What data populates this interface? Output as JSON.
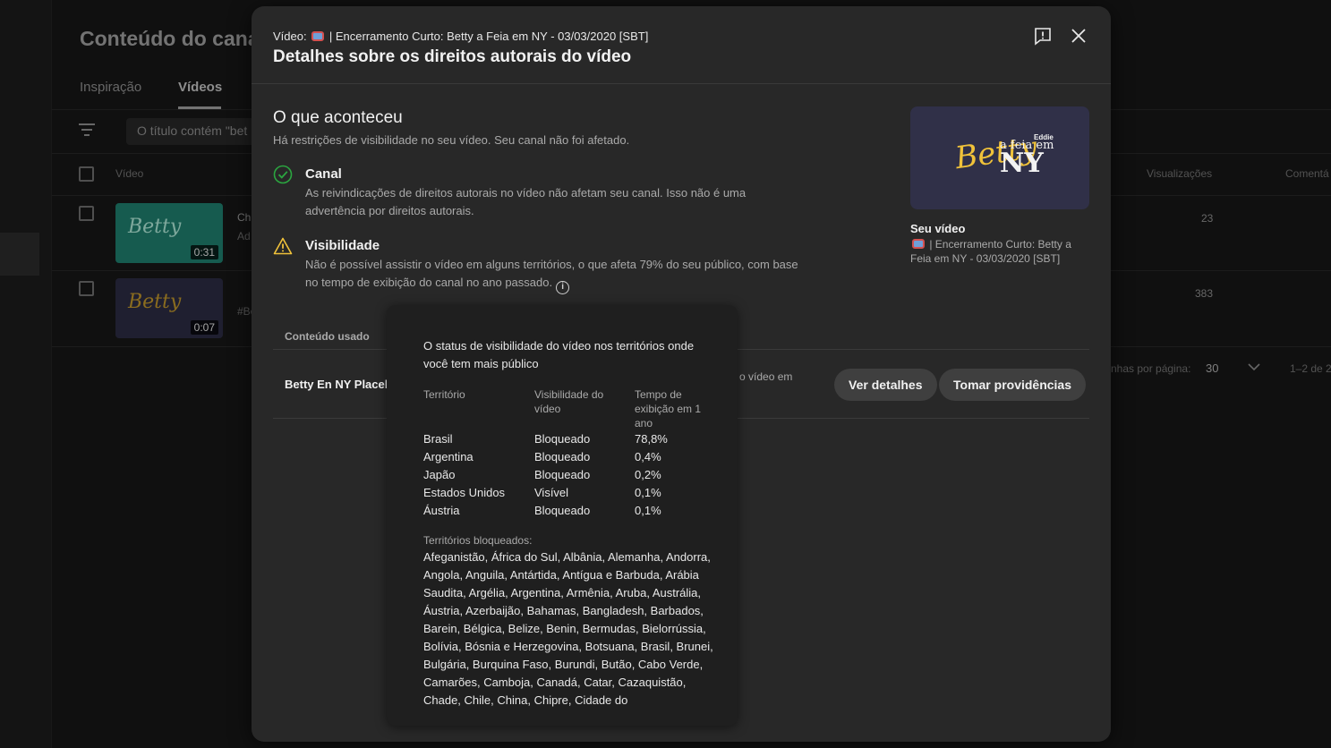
{
  "background": {
    "page_title": "Conteúdo do canal",
    "tabs": [
      "Inspiração",
      "Vídeos"
    ],
    "filter_text": "O título contém \"bet",
    "columns": {
      "video": "Vídeo",
      "views": "Visualizações",
      "comments": "Comentá"
    },
    "rows": [
      {
        "thumb_text": "Betty",
        "duration": "0:31",
        "title_snip": "Ch",
        "desc_snip": "Ad",
        "views": "23"
      },
      {
        "thumb_text": "Betty",
        "duration": "0:07",
        "title_snip": "",
        "desc_snip": "#Be",
        "views": "383"
      }
    ],
    "footer": {
      "rows_per_page_label": "nhas por página:",
      "rows_per_page_value": "30",
      "range": "1–2 de 2"
    }
  },
  "dialog": {
    "subtitle_prefix": "Vídeo:",
    "subtitle_rest": "| Encerramento Curto: Betty a Feia em NY - 03/03/2020 [SBT]",
    "title": "Detalhes sobre os direitos autorais do vídeo",
    "what_happened": {
      "title": "O que aconteceu",
      "subtitle": "Há restrições de visibilidade no seu vídeo. Seu canal não foi afetado."
    },
    "channel": {
      "title": "Canal",
      "text": "As reivindicações de direitos autorais no vídeo não afetam seu canal. Isso não é uma advertência por direitos autorais."
    },
    "visibility": {
      "title": "Visibilidade",
      "text": "Não é possível assistir o vídeo em alguns territórios, o que afeta 79% do seu público, com base no tempo de exibição do canal no ano passado."
    },
    "your_video": {
      "label": "Seu vídeo",
      "title": "| Encerramento Curto: Betty a Feia em NY - 03/03/2020 [SBT]",
      "thumb_betty": "Betty",
      "thumb_afeia": "a feia em",
      "thumb_ny": "NY",
      "thumb_eddie": "Eddie"
    },
    "content_used": {
      "header": "Conteúdo usado",
      "row_name": "Betty En NY Placeho",
      "row_desc": "o vídeo em",
      "ver_detalhes": "Ver detalhes",
      "tomar_providencias": "Tomar providências"
    }
  },
  "tooltip": {
    "heading": "O status de visibilidade do vídeo nos territórios onde você tem mais público",
    "col_territory": "Território",
    "col_visibility": "Visibilidade do vídeo",
    "col_watchtime": "Tempo de exibição em 1 ano",
    "rows": [
      {
        "territory": "Brasil",
        "visibility": "Bloqueado",
        "watchtime": "78,8%"
      },
      {
        "territory": "Argentina",
        "visibility": "Bloqueado",
        "watchtime": "0,4%"
      },
      {
        "territory": "Japão",
        "visibility": "Bloqueado",
        "watchtime": "0,2%"
      },
      {
        "territory": "Estados Unidos",
        "visibility": "Visível",
        "watchtime": "0,1%"
      },
      {
        "territory": "Áustria",
        "visibility": "Bloqueado",
        "watchtime": "0,1%"
      }
    ],
    "blocked_label": "Territórios bloqueados:",
    "blocked_list": "Afeganistão, África do Sul, Albânia, Alemanha, Andorra, Angola, Anguila, Antártida, Antígua e Barbuda, Arábia Saudita, Argélia, Argentina, Armênia, Aruba, Austrália, Áustria, Azerbaijão, Bahamas, Bangladesh, Barbados, Barein, Bélgica, Belize, Benin, Bermudas, Bielorrússia, Bolívia, Bósnia e Herzegovina, Botsuana, Brasil, Brunei, Bulgária, Burquina Faso, Burundi, Butão, Cabo Verde, Camarões, Camboja, Canadá, Catar, Cazaquistão, Chade, Chile, China, Chipre, Cidade do"
  },
  "colors": {
    "check_green": "#2ba640",
    "warning_yellow": "#f0c23a",
    "thumb_teal": "#1e7a6a",
    "thumb_navy": "#2a2a40"
  }
}
